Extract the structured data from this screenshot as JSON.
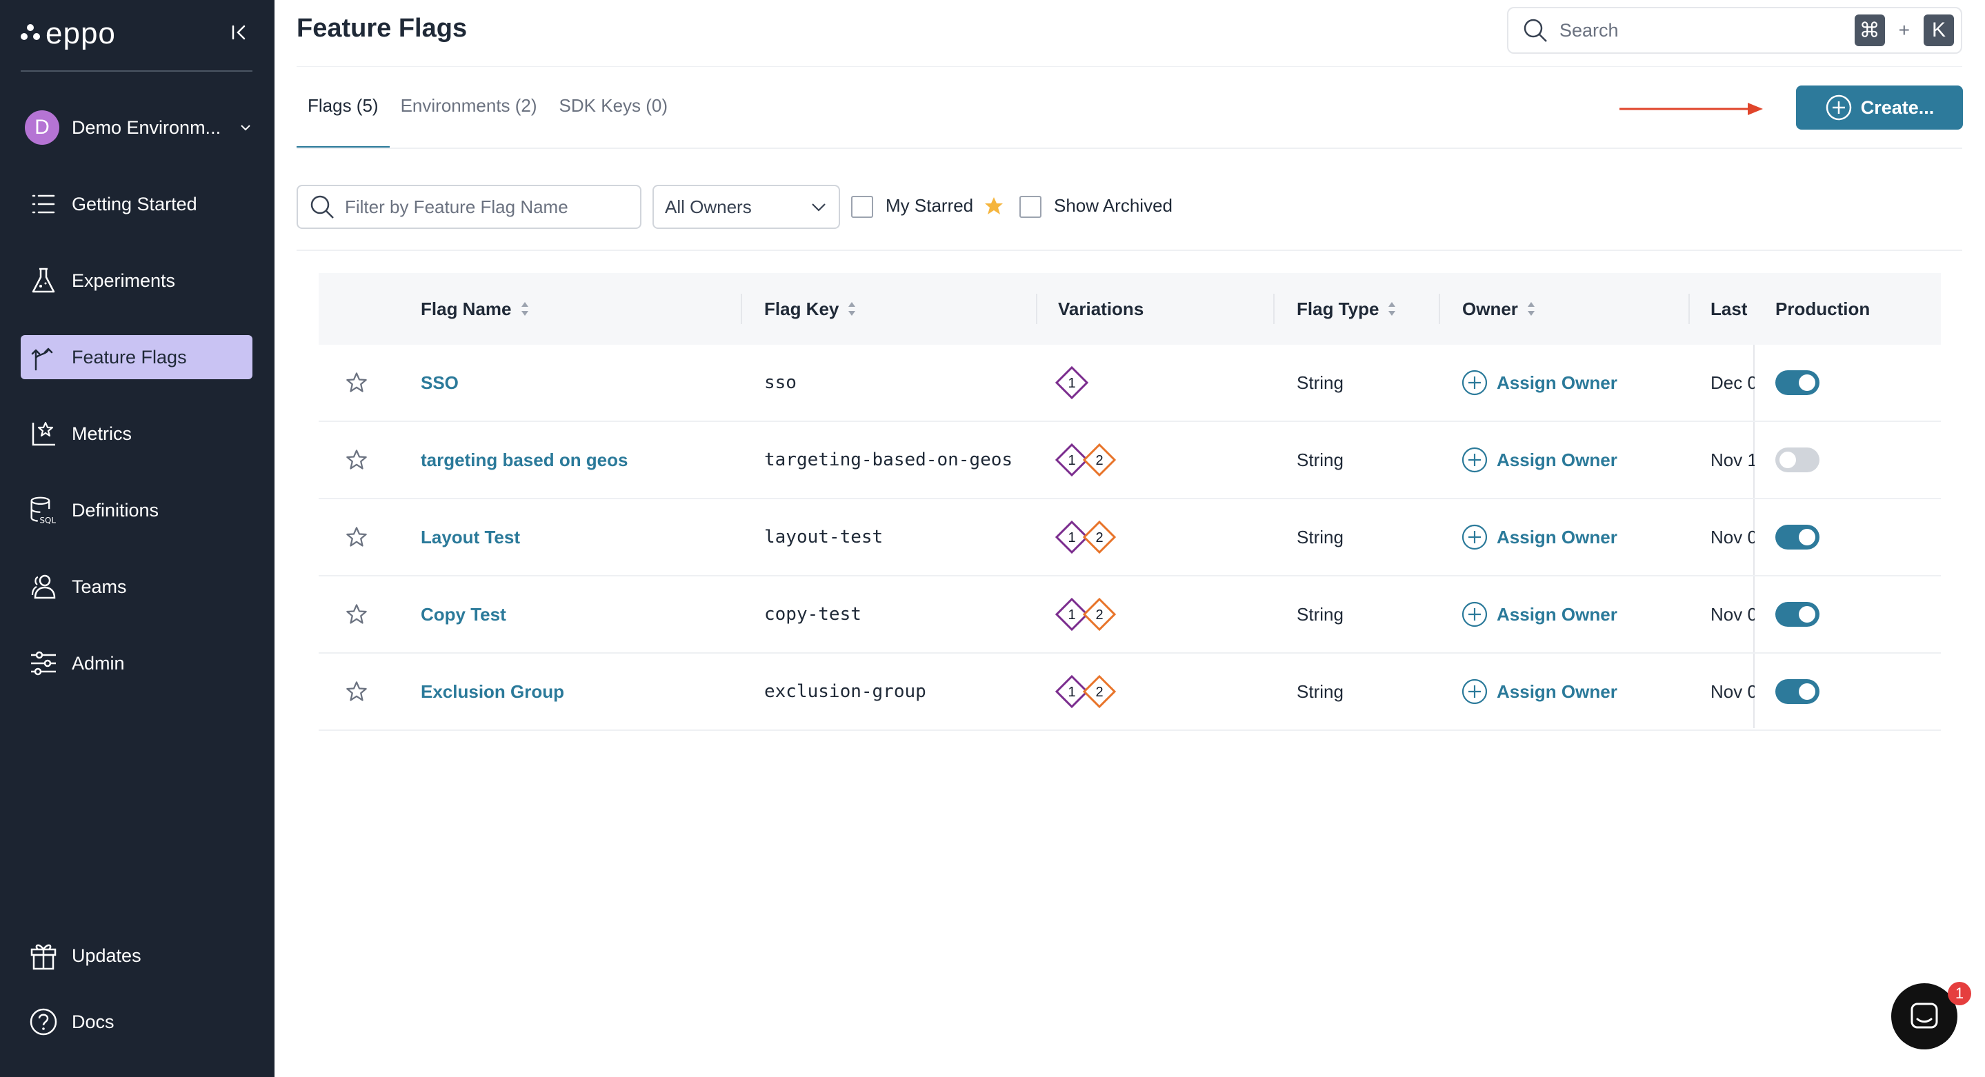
{
  "app": {
    "logo_text": "eppo"
  },
  "sidebar": {
    "environment": {
      "avatar_letter": "D",
      "label": "Demo Environm..."
    },
    "items": [
      {
        "label": "Getting Started",
        "icon": "list-icon"
      },
      {
        "label": "Experiments",
        "icon": "flask-icon"
      },
      {
        "label": "Feature Flags",
        "icon": "flag-branch-icon",
        "active": true
      },
      {
        "label": "Metrics",
        "icon": "chart-star-icon"
      },
      {
        "label": "Definitions",
        "icon": "database-sql-icon"
      },
      {
        "label": "Teams",
        "icon": "people-icon"
      },
      {
        "label": "Admin",
        "icon": "sliders-icon"
      }
    ],
    "bottom_items": [
      {
        "label": "Updates",
        "icon": "gift-icon"
      },
      {
        "label": "Docs",
        "icon": "help-circle-icon"
      }
    ]
  },
  "header": {
    "title": "Feature Flags",
    "search_placeholder": "Search",
    "shortcut_cmd": "⌘",
    "shortcut_plus": "+",
    "shortcut_key": "K"
  },
  "tabs": [
    {
      "label": "Flags (5)",
      "active": true
    },
    {
      "label": "Environments (2)"
    },
    {
      "label": "SDK Keys (0)"
    }
  ],
  "create_button": "Create...",
  "filters": {
    "name_placeholder": "Filter by Feature Flag Name",
    "owners_value": "All Owners",
    "my_starred_label": "My Starred",
    "show_archived_label": "Show Archived"
  },
  "table": {
    "columns": [
      "Flag Name",
      "Flag Key",
      "Variations",
      "Flag Type",
      "Owner",
      "Last I",
      "Production"
    ],
    "rows": [
      {
        "name": "SSO",
        "key": "sso",
        "variations": [
          "1"
        ],
        "type": "String",
        "owner": "Assign Owner",
        "last": "Dec 0",
        "production": true
      },
      {
        "name": "targeting based on geos",
        "key": "targeting-based-on-geos",
        "variations": [
          "1",
          "2"
        ],
        "type": "String",
        "owner": "Assign Owner",
        "last": "Nov 1",
        "production": false
      },
      {
        "name": "Layout Test",
        "key": "layout-test",
        "variations": [
          "1",
          "2"
        ],
        "type": "String",
        "owner": "Assign Owner",
        "last": "Nov 0",
        "production": true
      },
      {
        "name": "Copy Test",
        "key": "copy-test",
        "variations": [
          "1",
          "2"
        ],
        "type": "String",
        "owner": "Assign Owner",
        "last": "Nov 0",
        "production": true
      },
      {
        "name": "Exclusion Group",
        "key": "exclusion-group",
        "variations": [
          "1",
          "2"
        ],
        "type": "String",
        "owner": "Assign Owner",
        "last": "Nov 0",
        "production": true
      }
    ]
  },
  "chat": {
    "badge": "1"
  },
  "colors": {
    "accent": "#2d7a9b",
    "link": "#2b7a9a",
    "sidebar_bg": "#1c2431",
    "active_nav": "#c9c3f3",
    "arrow": "#e0452b",
    "variation_1": "#7b2d8e",
    "variation_2": "#e8742a"
  }
}
